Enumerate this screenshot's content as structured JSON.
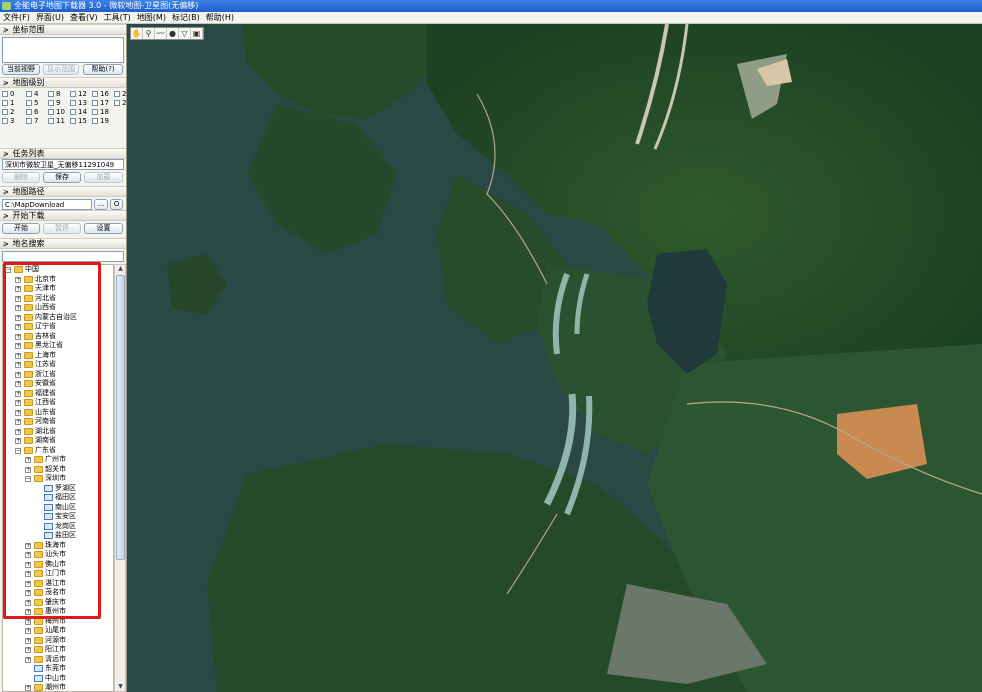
{
  "window": {
    "title": "全能电子地图下载器 3.0 - 微软地图-卫星图(无偏移)"
  },
  "menu": [
    "文件(F)",
    "界面(U)",
    "查看(V)",
    "工具(T)",
    "地图(M)",
    "标记(B)",
    "帮助(H)"
  ],
  "coord_section": {
    "title": "坐标范围",
    "buttons": {
      "current_view": "当前视野",
      "show_range": "显示范围",
      "help": "帮助(?)"
    }
  },
  "zoom_section": {
    "title": "地图级别",
    "levels": [
      "0",
      "4",
      "8",
      "12",
      "16",
      "20",
      "1",
      "5",
      "9",
      "13",
      "17",
      "21",
      "2",
      "6",
      "10",
      "14",
      "18",
      "3",
      "7",
      "11",
      "15",
      "19"
    ]
  },
  "task_section": {
    "title": "任务列表",
    "task_select": "深圳市微软卫星_无偏移11291049",
    "buttons": {
      "delete": "删除",
      "save": "保存",
      "load": "加载"
    }
  },
  "path_section": {
    "title": "地图路径",
    "path": "C:\\MapDownload",
    "browse": "...",
    "open": "O"
  },
  "download_section": {
    "title": "开始下载",
    "buttons": {
      "start": "开始",
      "pause": "暂停",
      "settings": "设置"
    }
  },
  "search_section": {
    "title": "地名搜索"
  },
  "tree": [
    {
      "label": "中国",
      "level": 0,
      "expander": "-",
      "kind": "folder"
    },
    {
      "label": "北京市",
      "level": 1,
      "expander": "+",
      "kind": "folder"
    },
    {
      "label": "天津市",
      "level": 1,
      "expander": "+",
      "kind": "folder"
    },
    {
      "label": "河北省",
      "level": 1,
      "expander": "+",
      "kind": "folder"
    },
    {
      "label": "山西省",
      "level": 1,
      "expander": "+",
      "kind": "folder"
    },
    {
      "label": "内蒙古自治区",
      "level": 1,
      "expander": "+",
      "kind": "folder"
    },
    {
      "label": "辽宁省",
      "level": 1,
      "expander": "+",
      "kind": "folder"
    },
    {
      "label": "吉林省",
      "level": 1,
      "expander": "+",
      "kind": "folder"
    },
    {
      "label": "黑龙江省",
      "level": 1,
      "expander": "+",
      "kind": "folder"
    },
    {
      "label": "上海市",
      "level": 1,
      "expander": "+",
      "kind": "folder"
    },
    {
      "label": "江苏省",
      "level": 1,
      "expander": "+",
      "kind": "folder"
    },
    {
      "label": "浙江省",
      "level": 1,
      "expander": "+",
      "kind": "folder"
    },
    {
      "label": "安徽省",
      "level": 1,
      "expander": "+",
      "kind": "folder"
    },
    {
      "label": "福建省",
      "level": 1,
      "expander": "+",
      "kind": "folder"
    },
    {
      "label": "江西省",
      "level": 1,
      "expander": "+",
      "kind": "folder"
    },
    {
      "label": "山东省",
      "level": 1,
      "expander": "+",
      "kind": "folder"
    },
    {
      "label": "河南省",
      "level": 1,
      "expander": "+",
      "kind": "folder"
    },
    {
      "label": "湖北省",
      "level": 1,
      "expander": "+",
      "kind": "folder"
    },
    {
      "label": "湖南省",
      "level": 1,
      "expander": "+",
      "kind": "folder"
    },
    {
      "label": "广东省",
      "level": 1,
      "expander": "-",
      "kind": "folder"
    },
    {
      "label": "广州市",
      "level": 2,
      "expander": "+",
      "kind": "folder"
    },
    {
      "label": "韶关市",
      "level": 2,
      "expander": "+",
      "kind": "folder"
    },
    {
      "label": "深圳市",
      "level": 2,
      "expander": "-",
      "kind": "folder"
    },
    {
      "label": "罗湖区",
      "level": 3,
      "expander": "",
      "kind": "district"
    },
    {
      "label": "福田区",
      "level": 3,
      "expander": "",
      "kind": "district"
    },
    {
      "label": "南山区",
      "level": 3,
      "expander": "",
      "kind": "district"
    },
    {
      "label": "宝安区",
      "level": 3,
      "expander": "",
      "kind": "district"
    },
    {
      "label": "龙岗区",
      "level": 3,
      "expander": "",
      "kind": "district"
    },
    {
      "label": "盐田区",
      "level": 3,
      "expander": "",
      "kind": "district"
    },
    {
      "label": "珠海市",
      "level": 2,
      "expander": "+",
      "kind": "folder"
    },
    {
      "label": "汕头市",
      "level": 2,
      "expander": "+",
      "kind": "folder"
    },
    {
      "label": "佛山市",
      "level": 2,
      "expander": "+",
      "kind": "folder"
    },
    {
      "label": "江门市",
      "level": 2,
      "expander": "+",
      "kind": "folder"
    },
    {
      "label": "湛江市",
      "level": 2,
      "expander": "+",
      "kind": "folder"
    },
    {
      "label": "茂名市",
      "level": 2,
      "expander": "+",
      "kind": "folder"
    },
    {
      "label": "肇庆市",
      "level": 2,
      "expander": "+",
      "kind": "folder"
    },
    {
      "label": "惠州市",
      "level": 2,
      "expander": "+",
      "kind": "folder"
    },
    {
      "label": "梅州市",
      "level": 2,
      "expander": "+",
      "kind": "folder"
    },
    {
      "label": "汕尾市",
      "level": 2,
      "expander": "+",
      "kind": "folder"
    },
    {
      "label": "河源市",
      "level": 2,
      "expander": "+",
      "kind": "folder"
    },
    {
      "label": "阳江市",
      "level": 2,
      "expander": "+",
      "kind": "folder"
    },
    {
      "label": "清远市",
      "level": 2,
      "expander": "+",
      "kind": "folder"
    },
    {
      "label": "东莞市",
      "level": 2,
      "expander": "",
      "kind": "district"
    },
    {
      "label": "中山市",
      "level": 2,
      "expander": "",
      "kind": "district"
    },
    {
      "label": "潮州市",
      "level": 2,
      "expander": "+",
      "kind": "folder"
    },
    {
      "label": "揭阳市",
      "level": 2,
      "expander": "+",
      "kind": "folder"
    }
  ],
  "map_tools": [
    "hand-icon",
    "marker-icon",
    "polyline-icon",
    "circle-icon",
    "polygon-icon",
    "rectangle-icon"
  ],
  "colors": {
    "highlight": "#e01818",
    "water": "#2b4a45",
    "forest": "#1f4424",
    "titlebar": "#2a6fd9"
  }
}
